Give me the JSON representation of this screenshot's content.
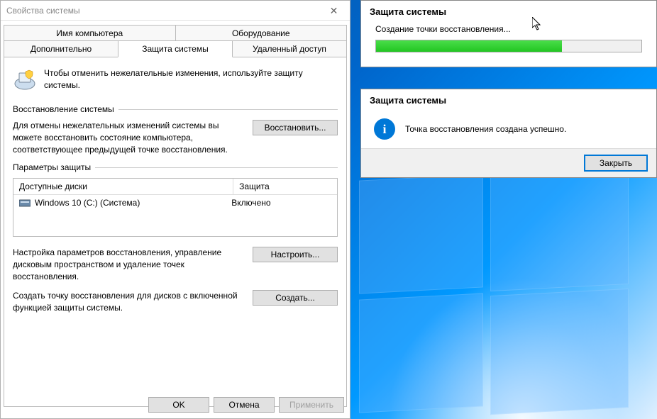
{
  "props": {
    "title": "Свойства системы",
    "tabs": {
      "computer_name": "Имя компьютера",
      "hardware": "Оборудование",
      "advanced": "Дополнительно",
      "protection": "Защита системы",
      "remote": "Удаленный доступ"
    },
    "intro": "Чтобы отменить нежелательные изменения, используйте защиту системы.",
    "restore_group": "Восстановление системы",
    "restore_desc": "Для отмены нежелательных изменений системы вы можете восстановить состояние компьютера, соответствующее предыдущей точке восстановления.",
    "restore_btn": "Восстановить...",
    "params_group": "Параметры защиты",
    "table": {
      "col_drives": "Доступные диски",
      "col_protection": "Защита",
      "rows": [
        {
          "name": "Windows 10 (C:) (Система)",
          "status": "Включено"
        }
      ]
    },
    "configure_desc": "Настройка параметров восстановления, управление дисковым пространством и удаление точек восстановления.",
    "configure_btn": "Настроить...",
    "create_desc": "Создать точку восстановления для дисков с включенной функцией защиты системы.",
    "create_btn": "Создать...",
    "ok": "OK",
    "cancel": "Отмена",
    "apply": "Применить"
  },
  "progress": {
    "title": "Защита системы",
    "label": "Создание точки восстановления...",
    "percent": 70
  },
  "success": {
    "title": "Защита системы",
    "message": "Точка восстановления создана успешно.",
    "close": "Закрыть"
  }
}
